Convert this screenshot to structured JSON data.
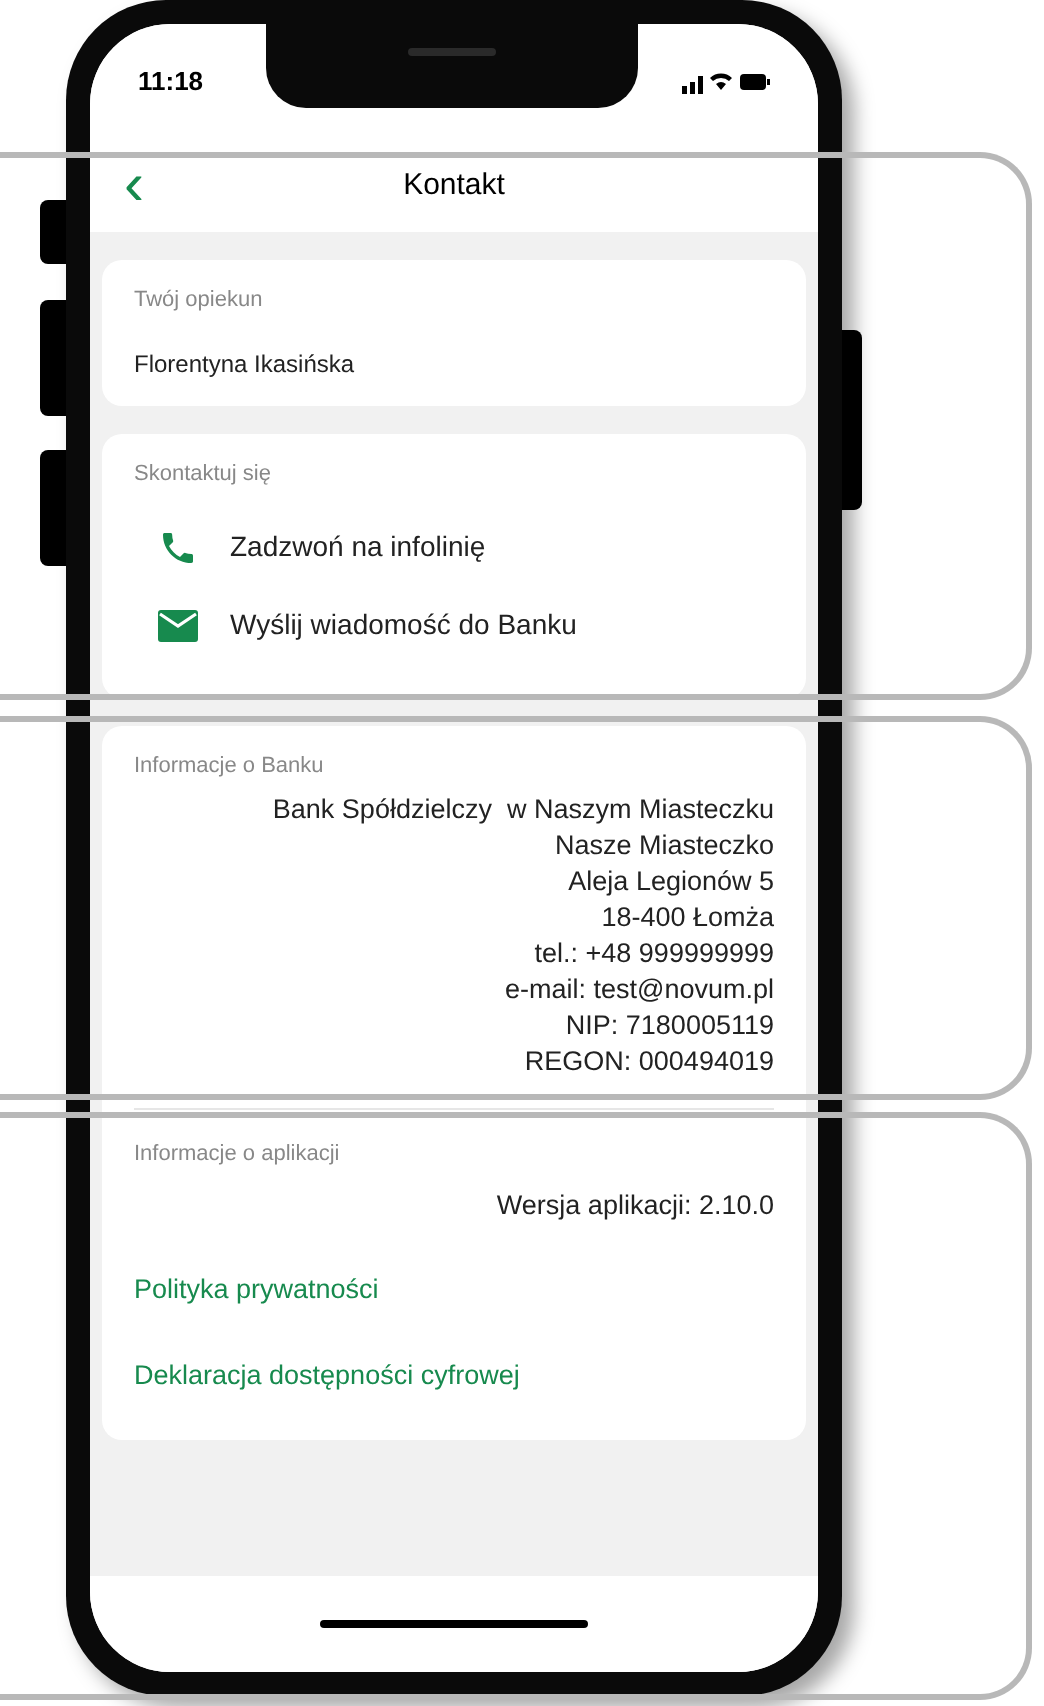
{
  "status_bar": {
    "time": "11:18"
  },
  "header": {
    "back": "‹",
    "title": "Kontakt"
  },
  "advisor": {
    "label": "Twój opiekun",
    "name": "Florentyna Ikasińska"
  },
  "contact": {
    "label": "Skontaktuj się",
    "actions": [
      {
        "kind": "phone",
        "text": "Zadzwoń na infolinię"
      },
      {
        "kind": "mail",
        "text": "Wyślij wiadomość do Banku"
      }
    ]
  },
  "bank_info": {
    "label": "Informacje o Banku",
    "lines": [
      "Bank Spółdzielczy  w Naszym Miasteczku",
      "Nasze Miasteczko",
      "Aleja Legionów 5",
      "18-400 Łomża",
      "tel.: +48 999999999",
      "e-mail: test@novum.pl",
      "NIP: 7180005119",
      "REGON: 000494019"
    ]
  },
  "app_info": {
    "label": "Informacje o aplikacji",
    "version": "Wersja aplikacji: 2.10.0"
  },
  "links": [
    "Polityka prywatności",
    "Deklaracja dostępności cyfrowej"
  ]
}
